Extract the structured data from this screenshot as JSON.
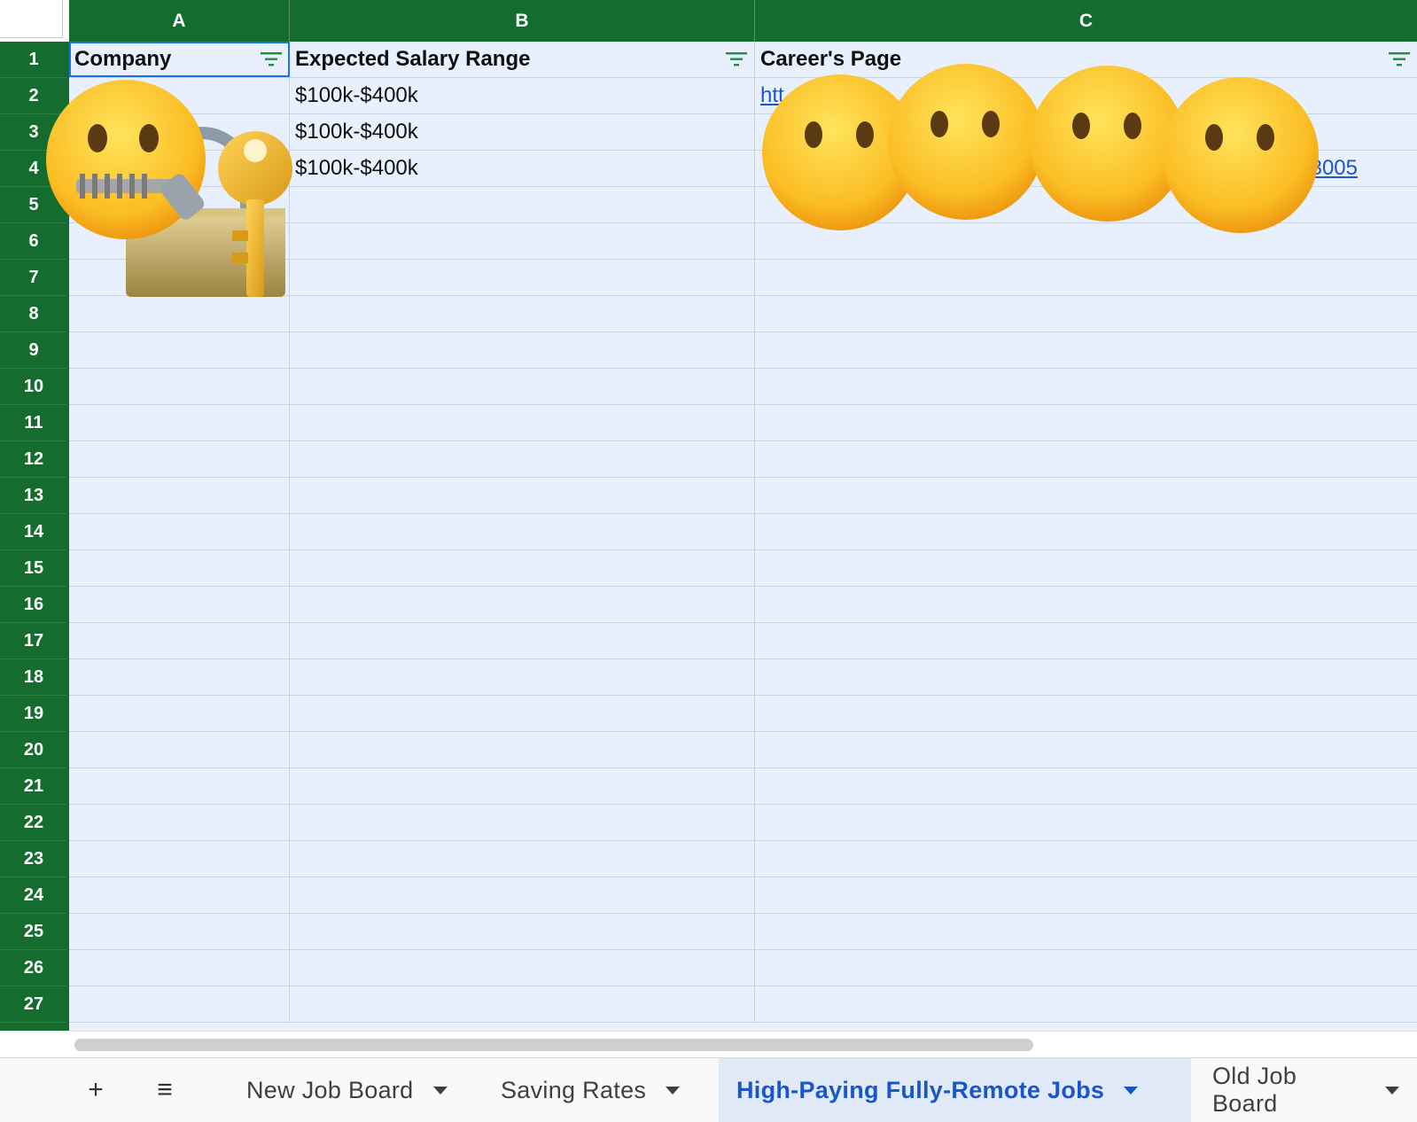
{
  "columns": [
    "A",
    "B",
    "C"
  ],
  "rows": [
    "1",
    "2",
    "3",
    "4",
    "5",
    "6",
    "7",
    "8",
    "9",
    "10",
    "11",
    "12",
    "13",
    "14",
    "15",
    "16",
    "17",
    "18",
    "19",
    "20",
    "21",
    "22",
    "23",
    "24",
    "25",
    "26",
    "27"
  ],
  "header_row": {
    "company": "Company",
    "salary": "Expected Salary Range",
    "careers": "Career's Page"
  },
  "data_rows": [
    {
      "salary": "$100k-$400k",
      "careers": "htt"
    },
    {
      "salary": "$100k-$400k",
      "careers": ""
    },
    {
      "salary": "$100k-$400k",
      "careers": "3005"
    }
  ],
  "tabs": {
    "add": "+",
    "menu": "≡",
    "sheets": [
      {
        "label": "New Job Board"
      },
      {
        "label": "Saving Rates"
      },
      {
        "label": "High-Paying Fully-Remote Jobs",
        "active": true
      },
      {
        "label": "Old Job Board"
      }
    ]
  },
  "colors": {
    "header_green": "#146c2e",
    "grid_fill": "#e8effd",
    "active_tab": "#1a55c9",
    "filter_icon": "#1e8e3e"
  },
  "icons": [
    "filter-icon",
    "zipper-mouth-face-icon",
    "locked-with-key-icon",
    "face-without-mouth-icon"
  ]
}
